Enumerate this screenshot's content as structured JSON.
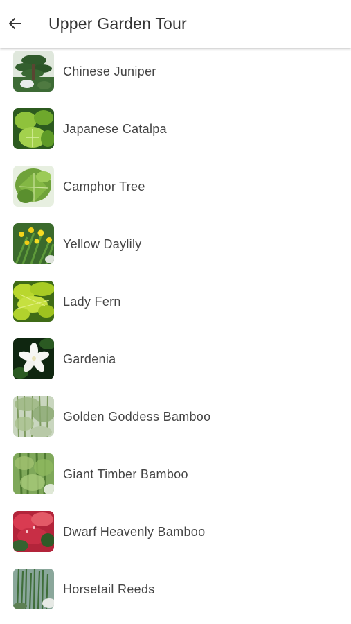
{
  "header": {
    "title": "Upper Garden Tour",
    "back_icon": "arrow-left-icon"
  },
  "plants": [
    {
      "name": "Chinese Juniper",
      "thumb": "juniper"
    },
    {
      "name": "Japanese Catalpa",
      "thumb": "catalpa"
    },
    {
      "name": "Camphor Tree",
      "thumb": "camphor"
    },
    {
      "name": "Yellow Daylily",
      "thumb": "daylily"
    },
    {
      "name": "Lady Fern",
      "thumb": "fern"
    },
    {
      "name": "Gardenia",
      "thumb": "gardenia"
    },
    {
      "name": "Golden Goddess Bamboo",
      "thumb": "golden-bamboo"
    },
    {
      "name": "Giant Timber Bamboo",
      "thumb": "timber-bamboo"
    },
    {
      "name": "Dwarf Heavenly Bamboo",
      "thumb": "heavenly-bamboo"
    },
    {
      "name": "Horsetail Reeds",
      "thumb": "horsetail"
    }
  ],
  "colors": {
    "background": "#ffffff",
    "text": "#444444",
    "title": "#333333"
  }
}
